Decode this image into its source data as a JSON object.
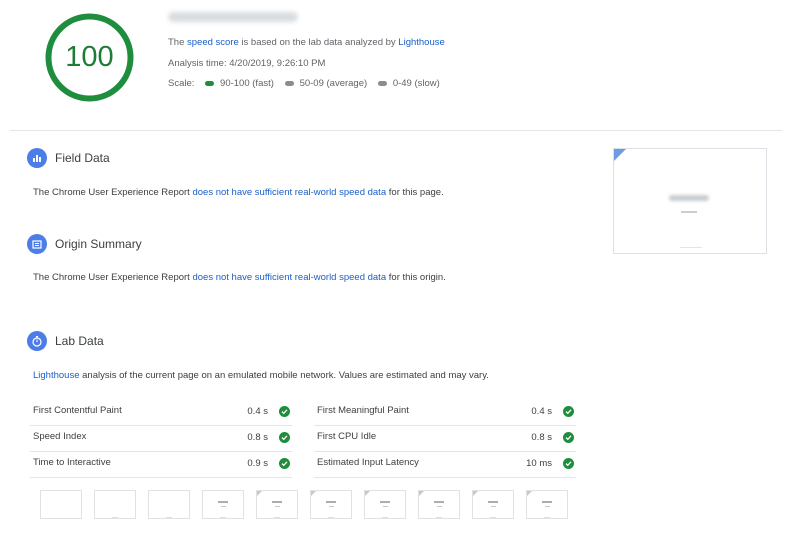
{
  "header": {
    "score": "100",
    "score_color": "#1e8e3e",
    "description": {
      "prefix": "The",
      "speed_score_link": "speed score",
      "middle": "is based on the lab data analyzed by",
      "lighthouse_link": "Lighthouse"
    },
    "analysis_time": "Analysis time: 4/20/2019, 9:26:10 PM",
    "scale": {
      "label": "Scale:",
      "items": [
        {
          "label": "90-100 (fast)",
          "color": "#1e8e3e"
        },
        {
          "label": "50-09 (average)",
          "color": "#8c8c8c"
        },
        {
          "label": "0-49 (slow)",
          "color": "#8c8c8c"
        }
      ]
    }
  },
  "field_data": {
    "title": "Field Data",
    "text_prefix": "The Chrome User Experience Report",
    "link": "does not have sufficient real-world speed data",
    "text_suffix": "for this page."
  },
  "origin_summary": {
    "title": "Origin Summary",
    "text_prefix": "The Chrome User Experience Report",
    "link": "does not have sufficient real-world speed data",
    "text_suffix": "for this origin."
  },
  "lab_data": {
    "title": "Lab Data",
    "intro_link": "Lighthouse",
    "intro_text": "analysis of the current page on an emulated mobile network. Values are estimated and may vary.",
    "metrics_left": [
      {
        "name": "First Contentful Paint",
        "value": "0.4 s"
      },
      {
        "name": "Speed Index",
        "value": "0.8 s"
      },
      {
        "name": "Time to Interactive",
        "value": "0.9 s"
      }
    ],
    "metrics_right": [
      {
        "name": "First Meaningful Paint",
        "value": "0.4 s"
      },
      {
        "name": "First CPU Idle",
        "value": "0.8 s"
      },
      {
        "name": "Estimated Input Latency",
        "value": "10 ms"
      }
    ]
  },
  "colors": {
    "accent_blue": "#4d7ee8",
    "link_blue": "#1a5fc8",
    "pass_green": "#1e8e3e"
  }
}
